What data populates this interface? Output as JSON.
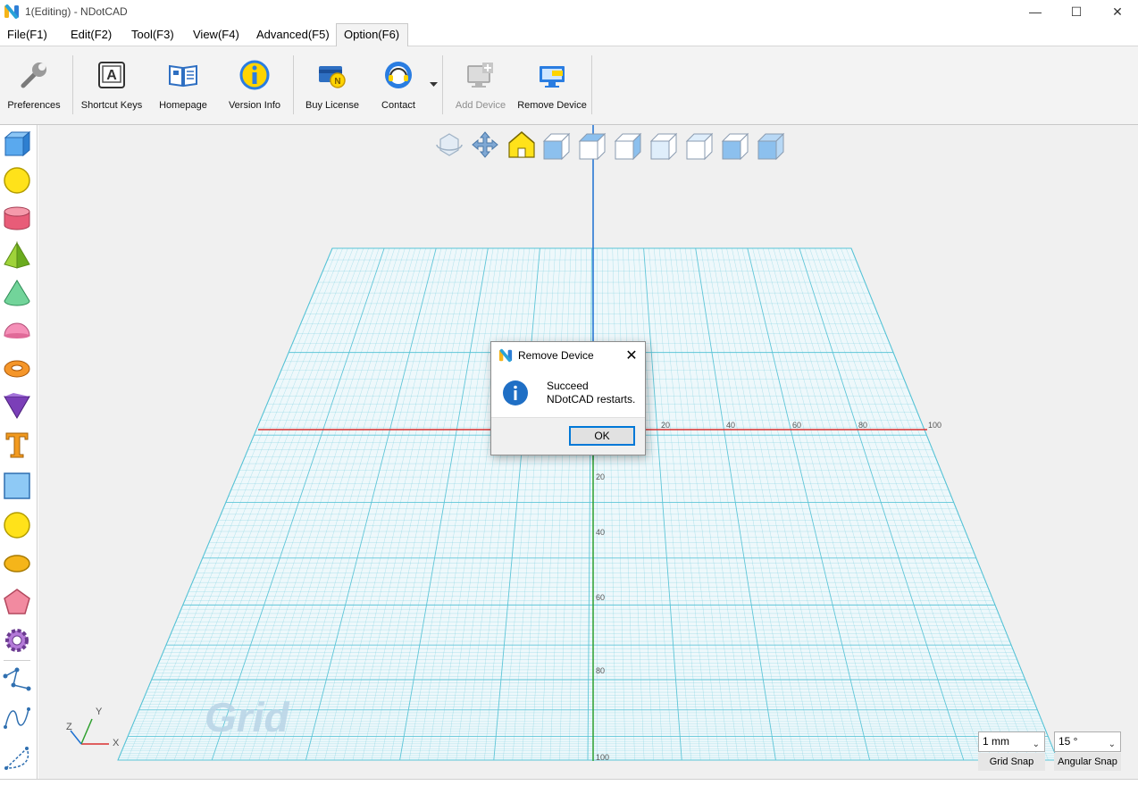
{
  "window": {
    "title": "1(Editing) - NDotCAD",
    "minimize": "—",
    "maximize": "☐",
    "close": "✕"
  },
  "menu": [
    {
      "label": "File(F1)"
    },
    {
      "label": "Edit(F2)"
    },
    {
      "label": "Tool(F3)"
    },
    {
      "label": "View(F4)"
    },
    {
      "label": "Advanced(F5)"
    },
    {
      "label": "Option(F6)"
    }
  ],
  "ribbon": {
    "preferences": "Preferences",
    "shortcut_keys": "Shortcut Keys",
    "homepage": "Homepage",
    "version_info": "Version Info",
    "buy_license": "Buy License",
    "contact": "Contact",
    "add_device": "Add Device",
    "remove_device": "Remove Device"
  },
  "viewport": {
    "watermark": "Grid",
    "x_ticks": [
      "20",
      "40",
      "60",
      "80",
      "100"
    ],
    "y_ticks": [
      "20",
      "40",
      "60",
      "80",
      "100"
    ],
    "axis_x": "X",
    "axis_y": "Y",
    "axis_z": "Z"
  },
  "snap": {
    "grid_value": "1 mm",
    "grid_label": "Grid Snap",
    "angular_value": "15 °",
    "angular_label": "Angular Snap"
  },
  "dialog": {
    "title": "Remove Device",
    "line1": "Succeed",
    "line2": "NDotCAD restarts.",
    "ok": "OK"
  },
  "colors": {
    "grid": "#58c3d6",
    "x_axis": "#d93030",
    "y_axis": "#2ea02e",
    "z_axis": "#1c6fd1",
    "accent": "#0078d7"
  }
}
